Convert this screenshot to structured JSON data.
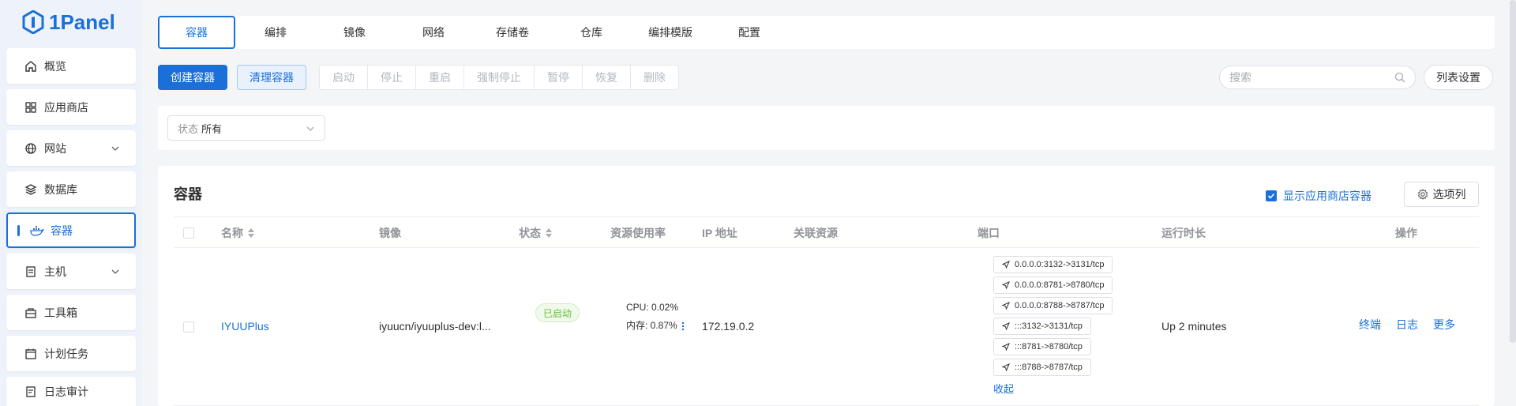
{
  "app": {
    "name": "1Panel"
  },
  "sidebar": {
    "items": [
      {
        "label": "概览",
        "icon": "home-icon"
      },
      {
        "label": "应用商店",
        "icon": "grid-icon"
      },
      {
        "label": "网站",
        "icon": "globe-icon"
      },
      {
        "label": "数据库",
        "icon": "layers-icon"
      },
      {
        "label": "容器",
        "icon": "docker-icon"
      },
      {
        "label": "主机",
        "icon": "server-icon"
      },
      {
        "label": "工具箱",
        "icon": "toolbox-icon"
      },
      {
        "label": "计划任务",
        "icon": "calendar-icon"
      },
      {
        "label": "日志审计",
        "icon": "log-icon"
      }
    ]
  },
  "tabs": [
    "容器",
    "编排",
    "镜像",
    "网络",
    "存储卷",
    "仓库",
    "编排模版",
    "配置"
  ],
  "toolbar": {
    "create": "创建容器",
    "clean": "清理容器",
    "group": [
      "启动",
      "停止",
      "重启",
      "强制停止",
      "暂停",
      "恢复",
      "删除"
    ],
    "search_placeholder": "搜索",
    "list_settings": "列表设置"
  },
  "filter": {
    "label": "状态",
    "value": "所有"
  },
  "panel": {
    "title": "容器",
    "show_app_containers": "显示应用商店容器",
    "columns_button": "选项列",
    "headers": {
      "name": "名称",
      "image": "镜像",
      "status": "状态",
      "resources": "资源使用率",
      "ip": "IP 地址",
      "related": "关联资源",
      "ports": "端口",
      "uptime": "运行时长",
      "actions": "操作"
    }
  },
  "rows": [
    {
      "name": "IYUUPlus",
      "image": "iyuucn/iyuuplus-dev:l...",
      "status": "已启动",
      "cpu": "CPU: 0.02%",
      "mem": "内存: 0.87%",
      "ip": "172.19.0.2",
      "ports": [
        "0.0.0.0:3132->3131/tcp",
        "0.0.0.0:8781->8780/tcp",
        "0.0.0.0:8788->8787/tcp",
        ":::3132->3131/tcp",
        ":::8781->8780/tcp",
        ":::8788->8787/tcp"
      ],
      "collapse": "收起",
      "uptime": "Up 2 minutes",
      "actions": [
        "终端",
        "日志",
        "更多"
      ]
    }
  ],
  "colors": {
    "accent": "#1a6fd8",
    "success": "#67c23a"
  }
}
